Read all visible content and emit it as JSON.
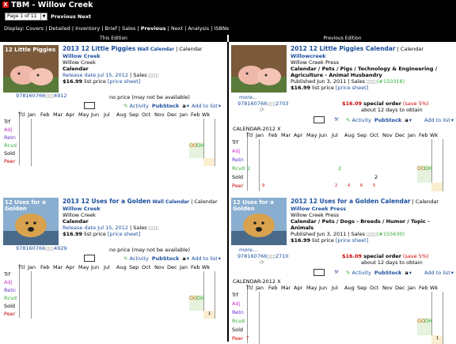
{
  "app": {
    "close": "X",
    "title": "TBM - Willow Creek",
    "page_select": "Page 1 of 11",
    "previous": "Previous",
    "next": "Next"
  },
  "display": {
    "prefix": "Display:",
    "items": [
      "Covers",
      "Detailed",
      "Inventory",
      "Brief",
      "Sales"
    ],
    "current": "Previous",
    "after": [
      "Next",
      "Analysis",
      "ISBNs"
    ]
  },
  "columns": {
    "left": "This Edition",
    "right": "Previous Edition"
  },
  "months": [
    "Ttl",
    "Jan",
    "Feb",
    "Mar",
    "Apr",
    "May",
    "Jun",
    "Jul",
    "Aug",
    "Sep",
    "Oct",
    "Nov",
    "Dec",
    "Jan",
    "Feb",
    "Wk"
  ],
  "rowlabels": [
    "Trf",
    "Adj",
    "Retn",
    "Rcvd",
    "Sold",
    "Peer"
  ],
  "items": [
    {
      "title": "2013 12 Little Piggies",
      "fmt": "Wall Calendar",
      "type": "| Calendar",
      "pub": "Willow Creek",
      "pub2": "Willow Creek",
      "cat": "Calendar",
      "date": "Release date Jul 15, 2012",
      "sales": "| Sales",
      "price": "$16.99",
      "pricesuffix": "list price",
      "pricesheet": "[price sheet]",
      "isbn_a": "978160766",
      "isbn_b": "4912",
      "noprice": "no price (may not be available)",
      "activity": "Activity",
      "pubstock": "PubStock",
      "addlist": "Add to list",
      "oo": "OO",
      "oh": "OH",
      "cover_text": "12 Little Piggies"
    },
    {
      "title": "2012 12 Little Piggies Calendar",
      "type": "| Calendar",
      "pub": "Willowcreek",
      "pub2": "Willow Creek Press",
      "cat": "Calendar / Pets / Pigs / Technology & Engineering / Agriculture - Animal Husbandry",
      "date": "Published Jun 3, 2011",
      "sales": "| Sales",
      "rank": "(#150318)",
      "price": "$16.99",
      "pricesuffix": "list price",
      "pricesheet": "[price sheet]",
      "more": "more...",
      "isbn_a": "978160766",
      "isbn_b": "2703",
      "special_price": "$16.09",
      "special": "special order",
      "save": "(save 5%)",
      "obtain": "about 12 days to obtain",
      "activity": "Activity",
      "pubstock": "PubStock",
      "addlist": "Add to list",
      "chart_label": "CALENDAR-2012 X",
      "oo": "OO",
      "oh": "OH",
      "rcvd_ttl": "2",
      "rcvd_mid": "2",
      "sold_mid": "2",
      "peer": [
        "9",
        "2",
        "4",
        "6",
        "5"
      ]
    },
    {
      "title": "2013 12 Uses for a Golden",
      "fmt": "Wall Calendar",
      "type": "| Calendar",
      "pub": "Willow Creek",
      "pub2": "Willow Creek",
      "cat": "Calendar",
      "date": "Release date Jul 15, 2012",
      "sales": "| Sales",
      "price": "$16.99",
      "pricesuffix": "list price",
      "pricesheet": "[price sheet]",
      "isbn_a": "978160766",
      "isbn_b": "4929",
      "noprice": "no price (may not be available)",
      "activity": "Activity",
      "pubstock": "PubStock",
      "addlist": "Add to list",
      "oo": "OO",
      "oh": "OH",
      "peer_wk": "1",
      "cover_text": "12 Uses for a Golden"
    },
    {
      "title": "2012 12 Uses for a Golden Calendar",
      "type": "| Calendar",
      "pub": "Willow Creek Press",
      "pub2": "Willow Creek Press",
      "cat": "Calendar / Pets / Dogs - Breeds / Humor / Topic - Animals",
      "date": "Published Jun 3, 2011",
      "sales": "| Sales",
      "rank": "(#155630)",
      "price": "$16.99",
      "pricesuffix": "list price",
      "pricesheet": "[price sheet]",
      "more": "more...",
      "isbn_a": "978160766",
      "isbn_b": "2710",
      "special_price": "$16.09",
      "special": "special order",
      "save": "(save 5%)",
      "obtain": "about 12 days to obtain",
      "activity": "Activity",
      "pubstock": "PubStock",
      "addlist": "Add to list",
      "chart_label": "CALENDAR-2012 X",
      "oo": "OO",
      "oh": "OH",
      "peer_ttl": "7",
      "peer_wk": "1",
      "cover_text": "12 Uses for a Golden"
    }
  ],
  "colors": {
    "header": "#000000",
    "link": "#1a4d9c",
    "special": "#cc0000",
    "rank": "#33aa33",
    "adj": "#cc33cc",
    "retn": "#6633cc",
    "rcvd": "#33aa33",
    "peer": "#cc0000"
  }
}
